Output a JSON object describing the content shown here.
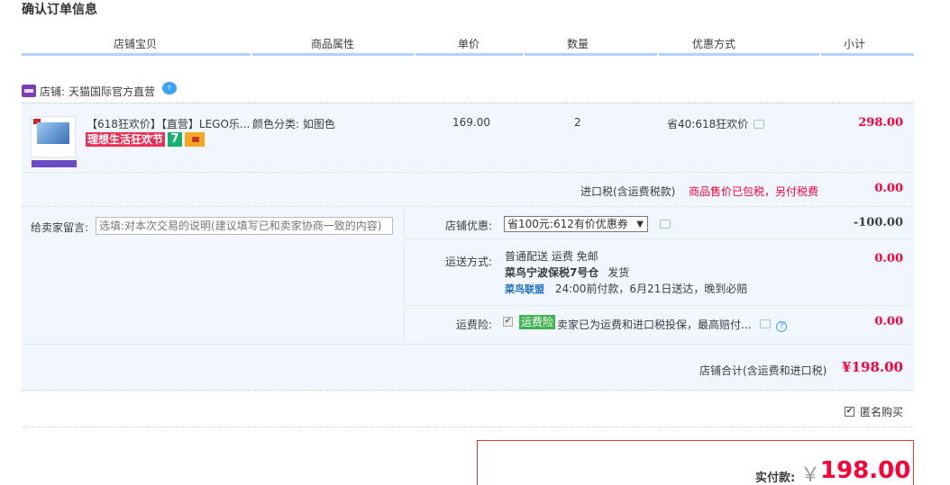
{
  "page_title": "确认订单信息",
  "columns": [
    "店铺宝贝",
    "商品属性",
    "单价",
    "数量",
    "优惠方式",
    "小计"
  ],
  "shop": {
    "label": "店铺:",
    "name": "天猫国际官方直营"
  },
  "item": {
    "title": "【618狂欢价】【直营】LEGO乐...",
    "promo_tag": "理想生活狂欢节",
    "promo_badge": "7",
    "attribute": "颜色分类: 如图色",
    "unit_price": "169.00",
    "quantity": "2",
    "discount": "省40:618狂欢价",
    "subtotal": "298.00"
  },
  "tax": {
    "label": "进口税(含运费税款)",
    "note": "商品售价已包税，另付税费",
    "value": "0.00"
  },
  "message": {
    "label": "给卖家留言:",
    "placeholder": "选填:对本次交易的说明(建议填写已和卖家协商一致的内容)"
  },
  "shop_coupon": {
    "label": "店铺优惠:",
    "selected": "省100元:612有价优惠券",
    "value": "-100.00"
  },
  "shipping": {
    "label": "运送方式:",
    "method": "普通配送 运费 免邮",
    "warehouse": "菜鸟宁波保税7号仓",
    "dispatch": "发货",
    "carrier": "菜鸟联盟",
    "promise": "24:00前付款，6月21日送达，晚到必赔",
    "value": "0.00"
  },
  "insurance": {
    "label": "运费险:",
    "tag": "运费险",
    "text": "卖家已为运费和进口税投保，最高赔付...",
    "value": "0.00"
  },
  "shop_total": {
    "label": "店铺合计(含运费和进口税)",
    "value": "¥198.00"
  },
  "anonymous": {
    "label": "匿名购买",
    "checked": true
  },
  "payment": {
    "label": "实付款:",
    "currency": "￥",
    "amount": "198.00"
  },
  "colors": {
    "accent_red": "#ff0036",
    "row_bg": "#f2f7ff",
    "header_line": "#b2d1ff"
  }
}
